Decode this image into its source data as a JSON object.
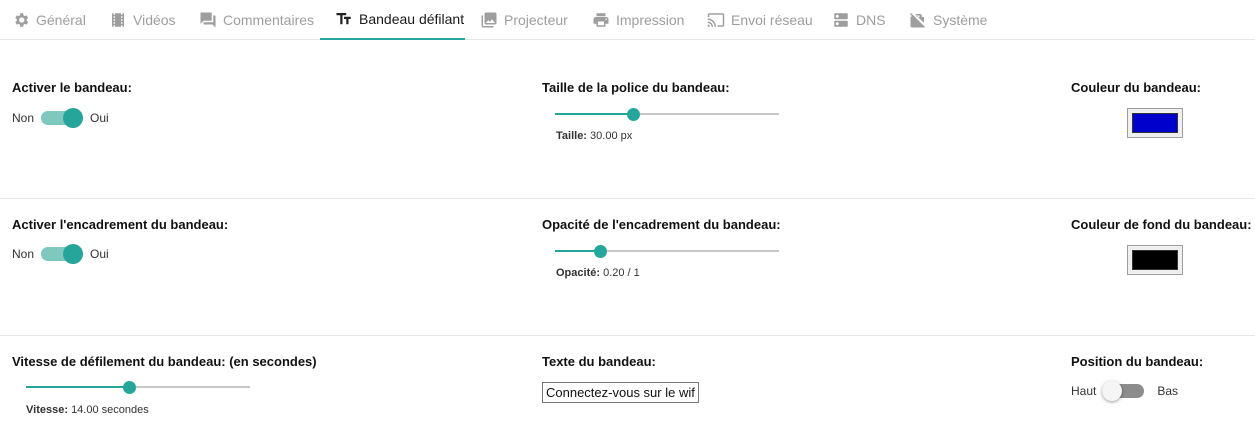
{
  "tabs": [
    {
      "label": "Général",
      "icon": "gear-icon",
      "active": false
    },
    {
      "label": "Vidéos",
      "icon": "film-icon",
      "active": false
    },
    {
      "label": "Commentaires",
      "icon": "comment-icon",
      "active": false
    },
    {
      "label": "Bandeau défilant",
      "icon": "text-size-icon",
      "active": true
    },
    {
      "label": "Projecteur",
      "icon": "image-icon",
      "active": false
    },
    {
      "label": "Impression",
      "icon": "printer-icon",
      "active": false
    },
    {
      "label": "Envoi réseau",
      "icon": "cast-icon",
      "active": false
    },
    {
      "label": "DNS",
      "icon": "dns-server-icon",
      "active": false
    },
    {
      "label": "Système",
      "icon": "system-icon",
      "active": false
    }
  ],
  "accent_color": "#26a69a",
  "banner_enable": {
    "label": "Activer le bandeau:",
    "off": "Non",
    "on": "Oui",
    "value": true
  },
  "font_size": {
    "label": "Taille de la police du bandeau:",
    "value_label": "Taille:",
    "value_text": "30.00 px",
    "fraction": 0.35
  },
  "banner_color": {
    "label": "Couleur du bandeau:",
    "value": "#0000cc"
  },
  "frame_enable": {
    "label": "Activer l'encadrement du bandeau:",
    "off": "Non",
    "on": "Oui",
    "value": true
  },
  "frame_opacity": {
    "label": "Opacité de l'encadrement du bandeau:",
    "value_label": "Opacité:",
    "value_text": "0.20 / 1",
    "fraction": 0.2
  },
  "background_color": {
    "label": "Couleur de fond du bandeau:",
    "value": "#000000"
  },
  "scroll_speed": {
    "label": "Vitesse de défilement du bandeau: (en secondes)",
    "value_label": "Vitesse:",
    "value_text": "14.00 secondes",
    "fraction": 0.46
  },
  "banner_text": {
    "label": "Texte du bandeau:",
    "value": "Connectez-vous sur le wifi :"
  },
  "banner_position": {
    "label": "Position du bandeau:",
    "off": "Haut",
    "on": "Bas",
    "value": false
  }
}
